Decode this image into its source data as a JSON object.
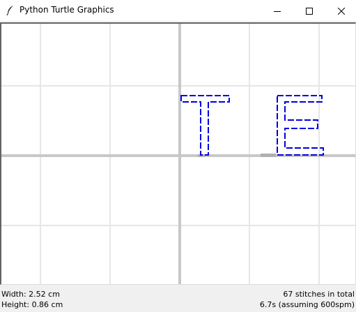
{
  "window": {
    "title": "Python Turtle Graphics",
    "controls": {
      "minimize_icon": "minimize-icon",
      "maximize_icon": "maximize-icon",
      "close_icon": "close-icon"
    }
  },
  "canvas": {
    "background": "#ffffff",
    "grid_color": "#e6e6e6",
    "axis_color": "#c8c8c8",
    "stitch_color": "#0000dd",
    "letters": [
      "T",
      "E"
    ]
  },
  "status": {
    "width": "Width: 2.52 cm",
    "height": "Height: 0.86 cm",
    "stitches": "67 stitches in total",
    "time": "6.7s (assuming 600spm)"
  }
}
